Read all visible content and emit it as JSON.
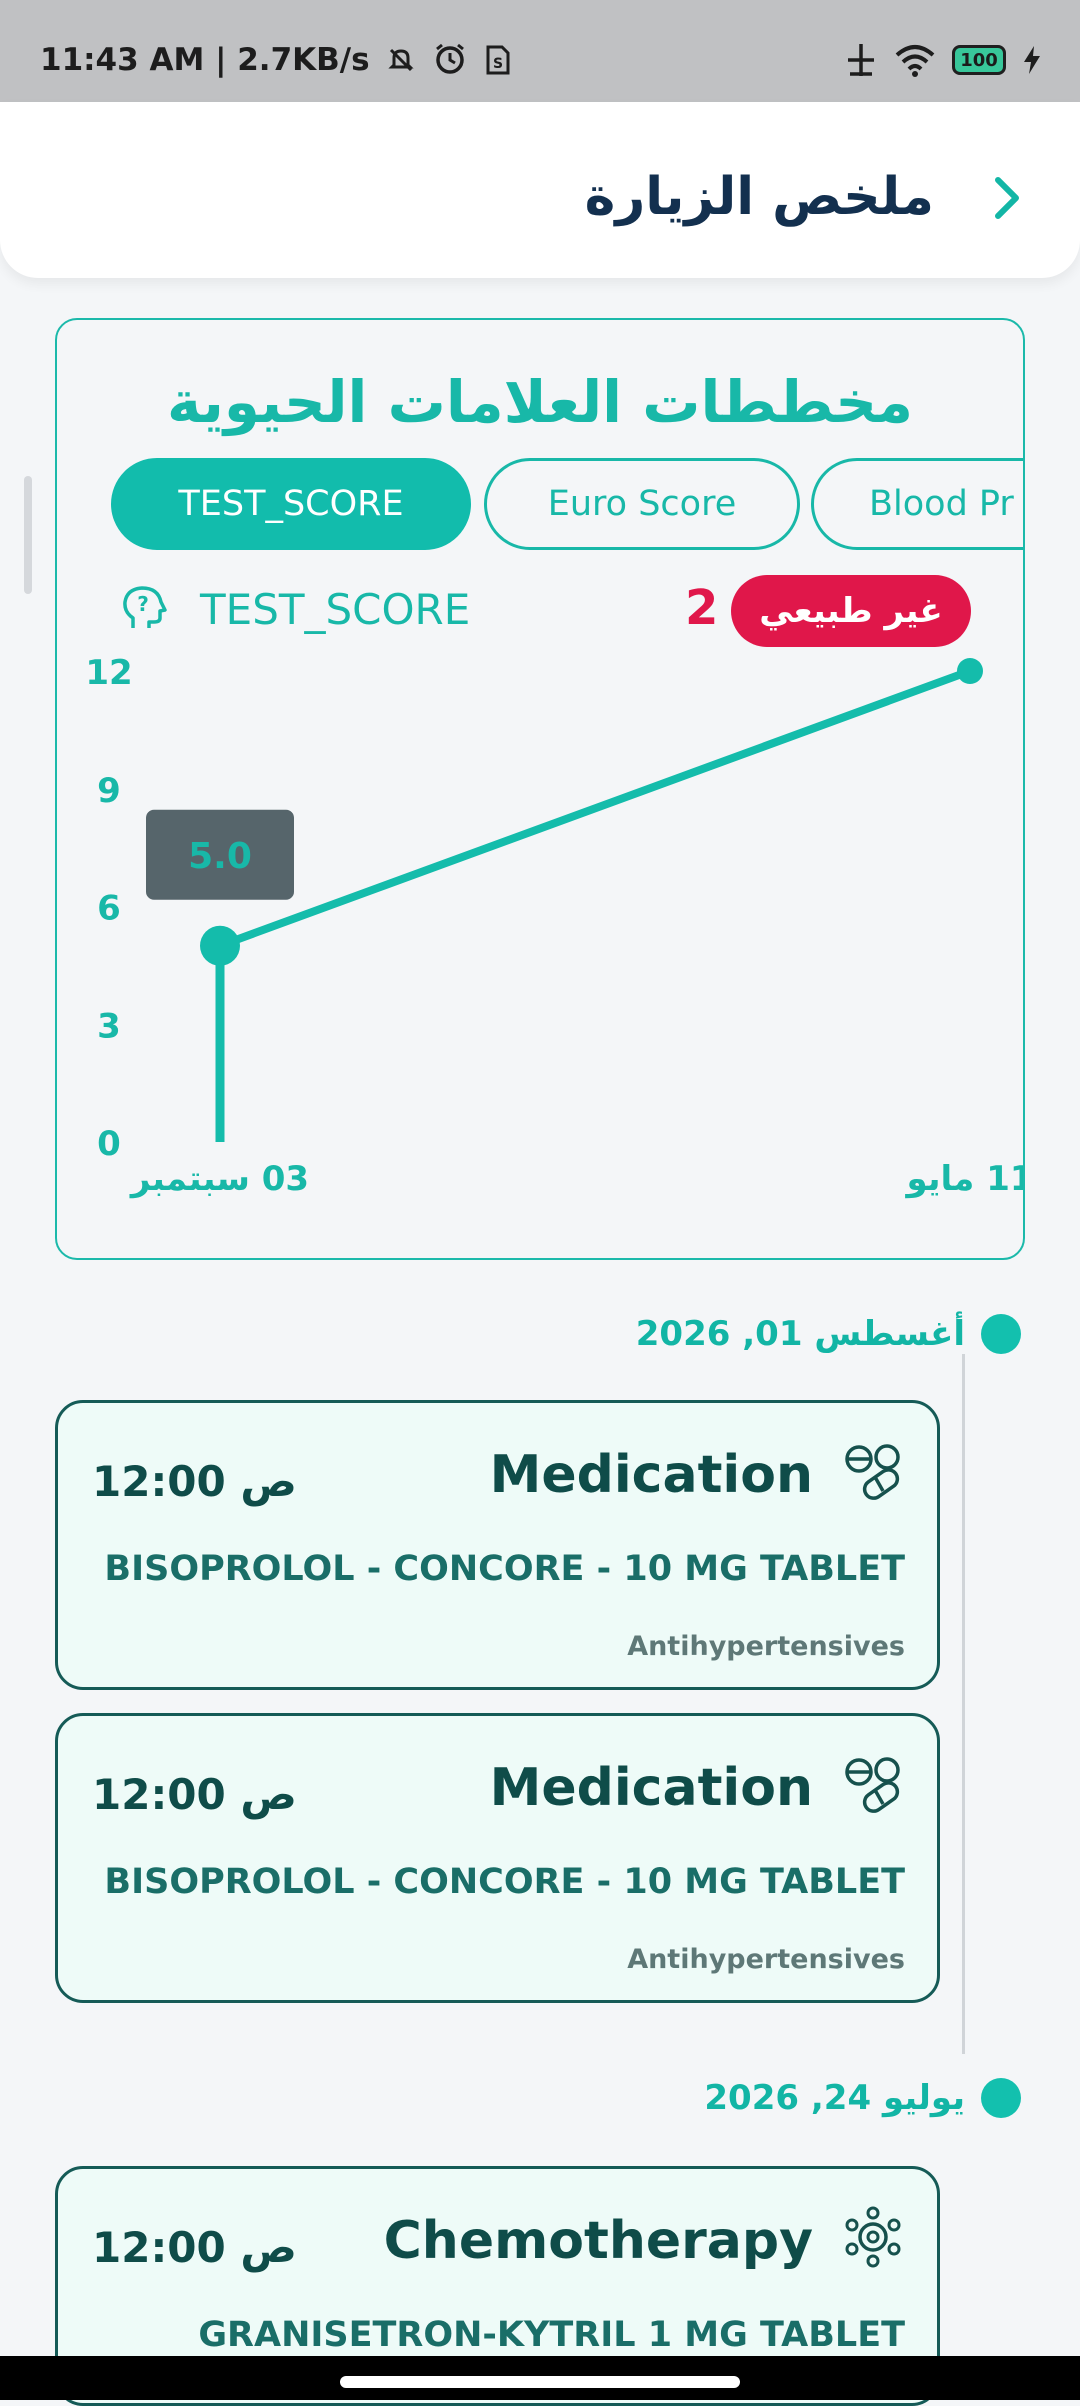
{
  "status_bar": {
    "time_text": "11:43 AM | 2.7KB/s",
    "battery": "100",
    "icons": [
      "mute-icon",
      "alarm-icon",
      "sim-icon",
      "network-icon",
      "wifi-icon",
      "battery-icon",
      "charging-icon"
    ]
  },
  "header": {
    "title": "ملخص الزيارة",
    "back_icon": "chevron-right-icon"
  },
  "vitals": {
    "title": "مخططات العلامات الحيوية",
    "tabs": [
      "TEST_SCORE",
      "Euro Score",
      "Blood Pr"
    ],
    "active_tab": "TEST_SCORE",
    "score_name": "TEST_SCORE",
    "abnormal_count": "2",
    "abnormal_label": "غير طبيعي",
    "tooltip_value": "5.0"
  },
  "chart_data": {
    "type": "line",
    "x": [
      "03 سبتمبر",
      "11 مايو"
    ],
    "series": [
      {
        "values": [
          5,
          12
        ]
      }
    ],
    "ylim": [
      0,
      12
    ],
    "yticks": [
      "0",
      "3",
      "6",
      "9",
      "12"
    ],
    "xticks": [
      "03 سبتمبر",
      "11 مايو"
    ],
    "color": "#14bcab",
    "grid": false
  },
  "timeline": {
    "groups": [
      {
        "date": "أغسطس 01, 2026",
        "events": [
          {
            "icon": "pills-icon",
            "type": "Medication",
            "time": "12:00 ص",
            "drug": "BISOPROLOL - CONCORE - 10 MG TABLET",
            "class": "Antihypertensives"
          },
          {
            "icon": "pills-icon",
            "type": "Medication",
            "time": "12:00 ص",
            "drug": "BISOPROLOL - CONCORE - 10 MG TABLET",
            "class": "Antihypertensives"
          }
        ]
      },
      {
        "date": "يوليو 24, 2026",
        "events": [
          {
            "icon": "chemotherapy-molecule-icon",
            "type": "Chemotherapy",
            "time": "12:00 ص",
            "drug": "GRANISETRON-KYTRIL 1 MG TABLET"
          }
        ]
      }
    ]
  }
}
